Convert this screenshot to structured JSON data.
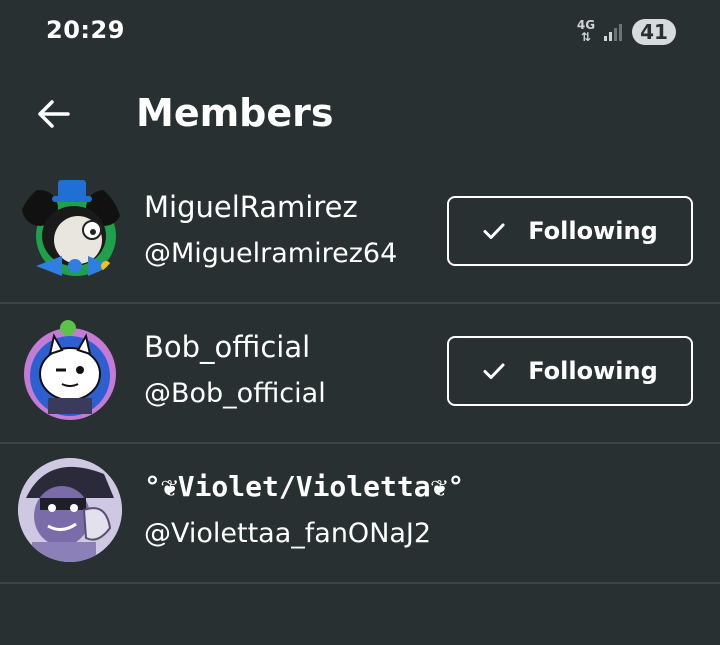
{
  "status_bar": {
    "time": "20:29",
    "network": "4G",
    "battery": "41"
  },
  "header": {
    "title": "Members",
    "back_icon": "arrow-left-icon"
  },
  "members": [
    {
      "name": "MiguelRamirez",
      "handle": "@Miguelramirez64",
      "button_label": "Following",
      "button_icon": "check-icon"
    },
    {
      "name": "Bob_official",
      "handle": "@Bob_official",
      "button_label": "Following",
      "button_icon": "check-icon"
    },
    {
      "name": "°❦Violet/Violetta❦°",
      "handle": "@Violettaa_fanONaJ2"
    }
  ],
  "colors": {
    "background": "#283031",
    "divider": "#3c4647",
    "text": "#ffffff"
  }
}
